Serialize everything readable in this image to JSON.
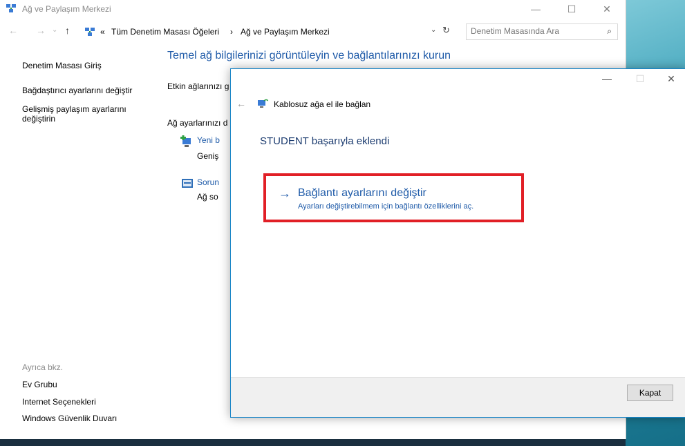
{
  "window": {
    "title": "Ağ ve Paylaşım Merkezi",
    "minimize": "—",
    "maximize": "☐",
    "close": "✕"
  },
  "address": {
    "back": "←",
    "forward": "→",
    "history": "⌄",
    "up": "↑",
    "overflow": "«",
    "crumbs": [
      "Tüm Denetim Masası Öğeleri",
      "Ağ ve Paylaşım Merkezi"
    ],
    "separator": "›",
    "dropdown": "⌄",
    "refresh": "↻"
  },
  "search": {
    "placeholder": "Denetim Masasında Ara",
    "icon": "⌕"
  },
  "sidebar": {
    "home": "Denetim Masası Giriş",
    "adapter": "Bağdaştırıcı ayarlarını değiştir",
    "sharing_line1": "Gelişmiş paylaşım ayarlarını",
    "sharing_line2": "değiştirin",
    "see_also": "Ayrıca bkz.",
    "homegroup": "Ev Grubu",
    "internet_options": "Internet Seçenekleri",
    "firewall": "Windows Güvenlik Duvarı"
  },
  "main": {
    "title": "Temel ağ bilgilerinizi görüntüleyin ve bağlantılarınızı kurun",
    "active_networks": "Etkin ağlarınızı g",
    "change_settings": "Ağ ayarlarınızı d",
    "new_conn_link": "Yeni b",
    "new_conn_desc": "Geniş",
    "troubleshoot_link": "Sorun",
    "troubleshoot_desc": "Ağ so"
  },
  "dialog": {
    "minimize": "—",
    "maximize": "☐",
    "close": "✕",
    "back": "←",
    "title": "Kablosuz ağa el ile bağlan",
    "heading": "STUDENT başarıyla eklendi",
    "command_arrow": "→",
    "command_main": "Bağlantı ayarlarını değiştir",
    "command_sub": "Ayarları değiştirebilmem için bağlantı özelliklerini aç.",
    "close_button": "Kapat"
  }
}
